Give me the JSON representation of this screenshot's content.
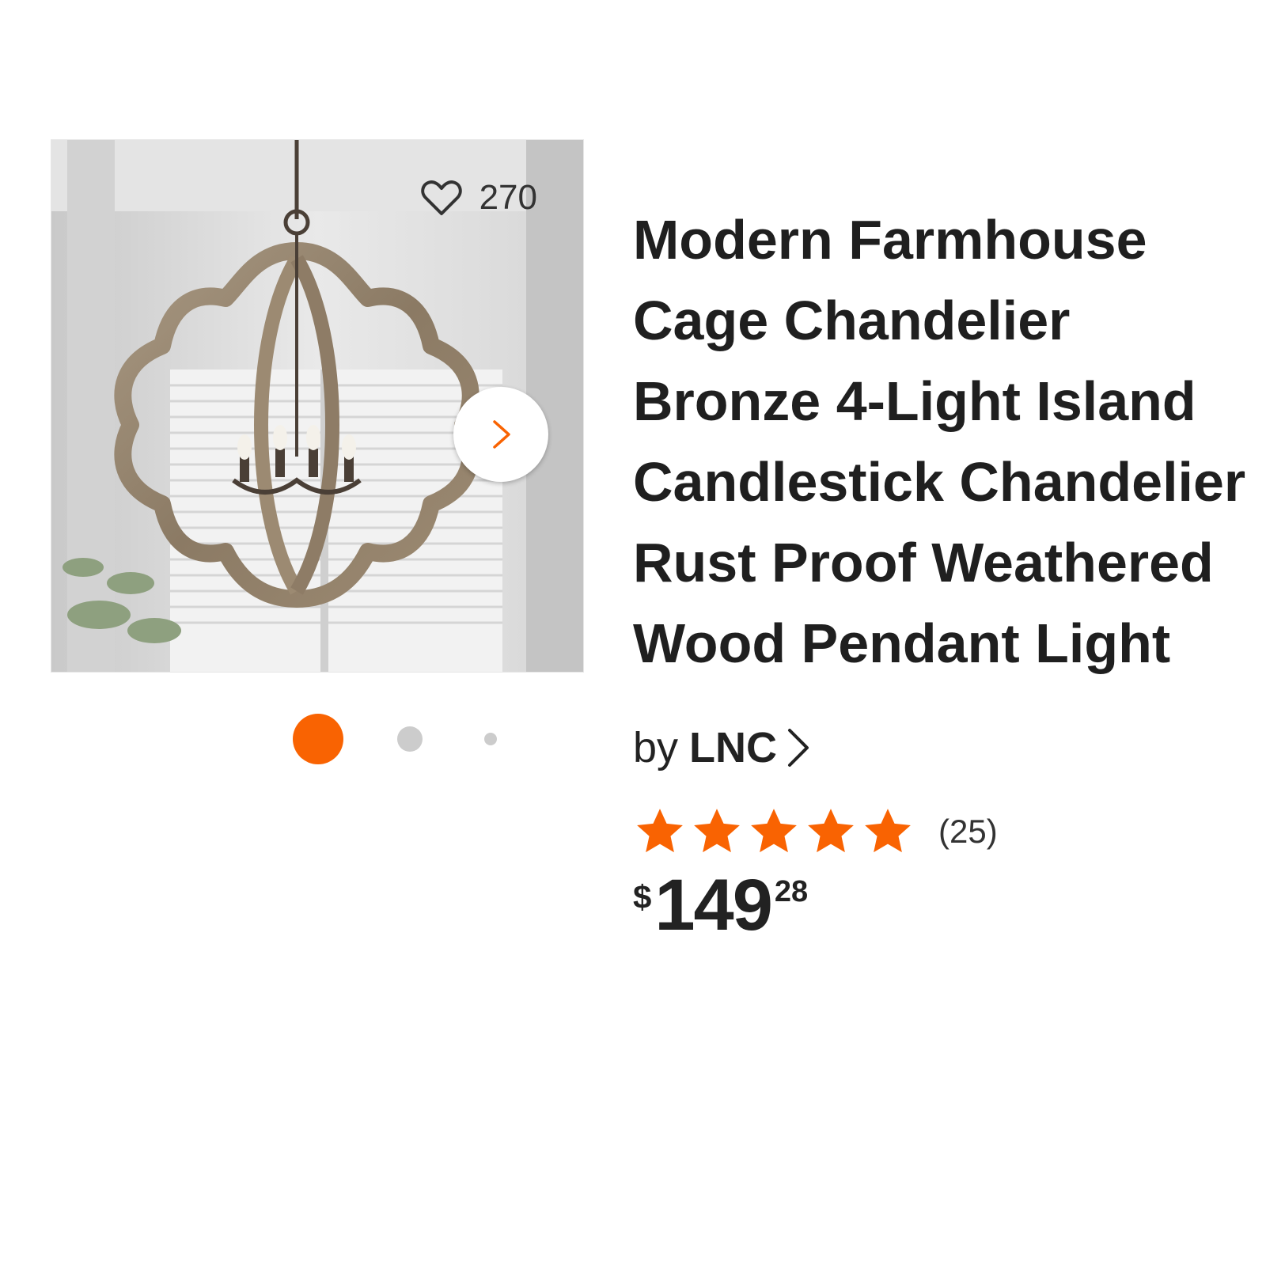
{
  "product": {
    "title": "Modern Farmhouse Cage Chandelier Bronze 4-Light Island Candlestick Chandelier Rust Proof Weathered Wood Pendant Light",
    "brand_prefix": "by",
    "brand": "LNC",
    "favorites_count": "270",
    "rating_out_of_5": 5,
    "review_count": "(25)",
    "price": {
      "currency_symbol": "$",
      "dollars": "149",
      "cents": "28"
    }
  },
  "gallery": {
    "image_count": 3,
    "active_index": 0
  },
  "icons": {
    "favorite": "heart-outline-icon",
    "next": "chevron-right-icon",
    "brand_link": "chevron-right-icon",
    "rating": "star-icon"
  },
  "colors": {
    "accent": "#f96302",
    "dot_inactive": "#cccccc",
    "text": "#1f1f1f"
  }
}
